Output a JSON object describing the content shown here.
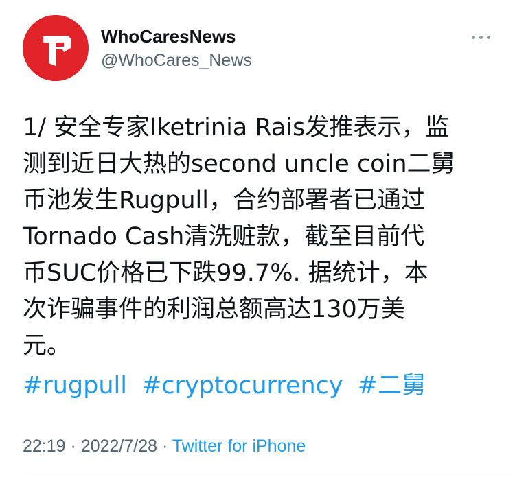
{
  "author": {
    "display_name": "WhoCaresNews",
    "handle": "@WhoCares_News",
    "avatar_icon": "whocaresnews-logo",
    "avatar_color": "#e0242a"
  },
  "more_icon": "more-options-icon",
  "tweet": {
    "lines": [
      "1/ 安全专家Iketrinia Rais发推表示，监",
      "测到近日大热的second uncle coin二舅",
      "币池发生Rugpull，合约部署者已通过",
      "Tornado Cash清洗赃款，截至目前代",
      "币SUC价格已下跌99.7%. 据统计，本",
      "次诈骗事件的利润总额高达130万美",
      "元。"
    ],
    "hashtags": [
      "#rugpull",
      "#cryptocurrency",
      "#二舅"
    ]
  },
  "meta": {
    "time": "22:19",
    "separator1": " · ",
    "date": "2022/7/28",
    "separator2": " · ",
    "source": "Twitter for iPhone"
  },
  "colors": {
    "link": "#1d9bf0",
    "secondary_text": "#536471",
    "primary_text": "#0f1419"
  }
}
